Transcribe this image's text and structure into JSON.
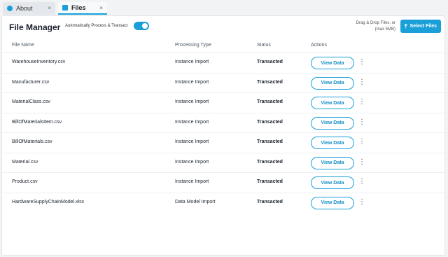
{
  "tabs": [
    {
      "label": "About",
      "close": "×"
    },
    {
      "label": "Files",
      "close": "×"
    }
  ],
  "header": {
    "title": "File Manager",
    "auto_label": "Automatically Process & Transact",
    "toggle_on": true,
    "drag_line1": "Drag & Drop Files, or",
    "drag_line2": "(max 5MB)",
    "select_label": "Select Files"
  },
  "table": {
    "columns": [
      "File Name",
      "Processing Type",
      "Status",
      "Actions"
    ],
    "action_label": "View Data",
    "kebab": "⋮",
    "rows": [
      {
        "name": "WarehouseInventory.csv",
        "type": "Instance Import",
        "status": "Transacted"
      },
      {
        "name": "Manufacturer.csv",
        "type": "Instance Import",
        "status": "Transacted"
      },
      {
        "name": "MaterialClass.csv",
        "type": "Instance Import",
        "status": "Transacted"
      },
      {
        "name": "BillOfMaterialsItem.csv",
        "type": "Instance Import",
        "status": "Transacted"
      },
      {
        "name": "BillOfMaterials.csv",
        "type": "Instance Import",
        "status": "Transacted"
      },
      {
        "name": "Material.csv",
        "type": "Instance Import",
        "status": "Transacted"
      },
      {
        "name": "Product.csv",
        "type": "Instance Import",
        "status": "Transacted"
      },
      {
        "name": "HardwareSupplyChainModel.xlsx",
        "type": "Data Model Import",
        "status": "Transacted"
      }
    ]
  },
  "colors": {
    "accent": "#1a9fd9"
  }
}
